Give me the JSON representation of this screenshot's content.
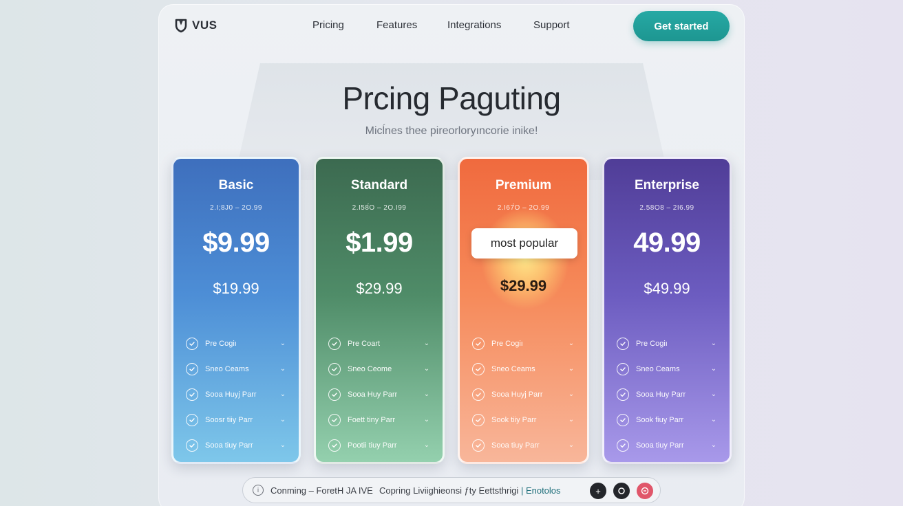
{
  "nav": {
    "logo_text": "VUS",
    "links": [
      "Pricing",
      "Features",
      "Integrations",
      "Support"
    ],
    "cta_label": "Get started"
  },
  "hero": {
    "title": "Prcing Paguting",
    "subtitle": "Micĺnes thee pireorloryıncorie inike!"
  },
  "plans": [
    {
      "name": "Basic",
      "range": "2.I;8J0 – 2O.99",
      "price": "$9.99",
      "alt_price": "$19.99",
      "features": [
        "Pre Cogiı",
        "Sneo Ceams",
        "Sooa Huyj Parr",
        "Soosr tiiy Parr",
        "Sooa tiuy Parr"
      ]
    },
    {
      "name": "Standard",
      "range": "2.I58́O – 2O.I99",
      "price": "$1.99",
      "alt_price": "$29.99",
      "features": [
        "Pre Coart",
        "Sneo Ceome",
        "Sooa Huy Parr",
        "Foett tiny Parr",
        "Pootii tiuy Parr"
      ]
    },
    {
      "name": "Premium",
      "range": "2.I67́O – 2O.99",
      "badge": "most popular",
      "price": "",
      "alt_price": "$29.99",
      "features": [
        "Pre Cogiı",
        "Sneo Ceams",
        "Sooa Huyj Parr",
        "Sook tiiy Parr",
        "Sooa tiuy Parr"
      ]
    },
    {
      "name": "Enterprise",
      "range": "2.58O8 – 2I6.99",
      "price": "49.99",
      "alt_price": "$49.99",
      "features": [
        "Pre Cogiı",
        "Sneo Ceams",
        "Sooa Huy Parr",
        "Sook fiuy Parr",
        "Sooa tiuy Parr"
      ]
    }
  ],
  "bottom_bar": {
    "text_left": "Conming – ForetH JA IVE",
    "text_right_prefix": "Copring Liviighieonsi ƒty Eettsthrigi",
    "text_right_link": "| Enotolos",
    "button_icons": [
      "plus-icon",
      "refresh-icon",
      "alert-icon"
    ]
  },
  "colors": {
    "accent": "#1f9e99",
    "basic": "#4d8ed6",
    "standard": "#4f8c68",
    "premium": "#f68a5a",
    "enterprise": "#6c5cc0"
  }
}
